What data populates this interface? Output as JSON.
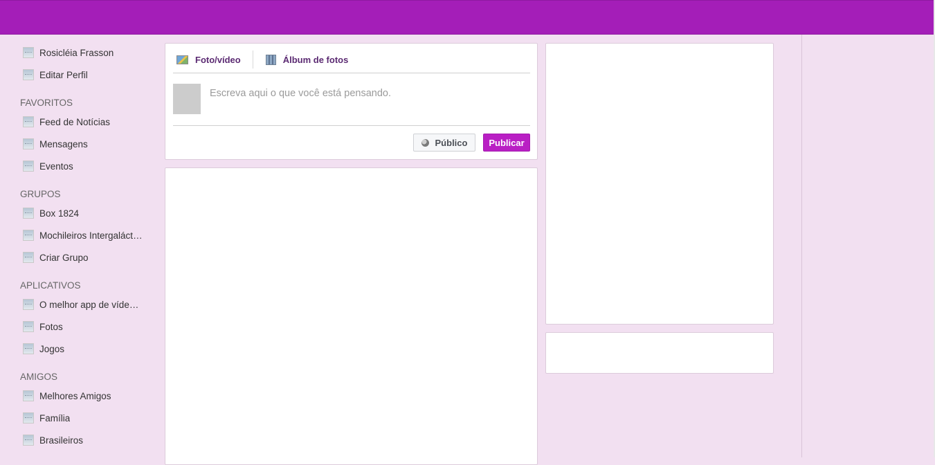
{
  "sidebar": {
    "profile_items": [
      {
        "label": "Rosicléia Frasson",
        "icon": "profile-thumbnail-icon"
      },
      {
        "label": "Editar Perfil",
        "icon": "edit-profile-icon"
      }
    ],
    "sections": [
      {
        "title": "FAVORITOS",
        "items": [
          {
            "label": "Feed de Notícias"
          },
          {
            "label": "Mensagens"
          },
          {
            "label": "Eventos"
          }
        ]
      },
      {
        "title": "GRUPOS",
        "items": [
          {
            "label": "Box 1824"
          },
          {
            "label": "Mochileiros Intergalácticos"
          },
          {
            "label": "Criar Grupo"
          }
        ]
      },
      {
        "title": "APLICATIVOS",
        "items": [
          {
            "label": "O melhor app de vídeo do mundo"
          },
          {
            "label": "Fotos"
          },
          {
            "label": "Jogos"
          }
        ]
      },
      {
        "title": "AMIGOS",
        "items": [
          {
            "label": "Melhores Amigos"
          },
          {
            "label": "Família"
          },
          {
            "label": "Brasileiros"
          }
        ]
      }
    ]
  },
  "composer": {
    "tab_photo_video": "Foto/vídeo",
    "tab_album": "Álbum de fotos",
    "placeholder": "Escreva aqui o que você está pensando.",
    "value": "",
    "privacy_label": "Público",
    "publish_label": "Publicar"
  },
  "colors": {
    "topbar": "#a41eb8",
    "background": "#f2e0f1",
    "publish_button": "#b91fc4",
    "tab_text": "#5b2a72"
  }
}
